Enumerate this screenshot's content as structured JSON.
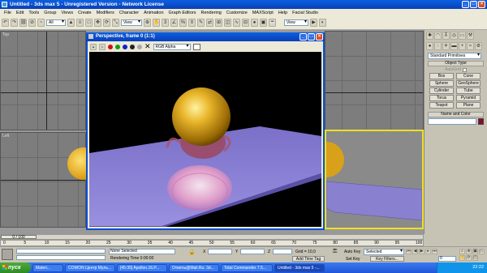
{
  "window": {
    "title": "Untitled - 3ds max 5 - Unregistered Version - Network License"
  },
  "menu": [
    "File",
    "Edit",
    "Tools",
    "Group",
    "Views",
    "Create",
    "Modifiers",
    "Character",
    "Animation",
    "Graph Editors",
    "Rendering",
    "Customize",
    "MAXScript",
    "Help",
    "Facial Studio"
  ],
  "toolbar": {
    "selection_filter": "All",
    "ref_coord": "View",
    "named_sel": "View"
  },
  "viewports": {
    "top": "Top",
    "left": "Left"
  },
  "render_window": {
    "title": "Perspective, frame 0 (1:1)",
    "channel": "RGB Alpha",
    "scene_colors": {
      "background": "#000000",
      "table": "#8a80d0",
      "sphere": "#d9a11a",
      "teapot": "#c06070"
    }
  },
  "command_panel": {
    "category": "Standard Primitives",
    "object_type_header": "Object Type",
    "autogrid": "AutoGrid",
    "buttons": [
      "Box",
      "Cone",
      "Sphere",
      "GeoSphere",
      "Cylinder",
      "Tube",
      "Torus",
      "Pyramid",
      "Teapot",
      "Plane"
    ],
    "name_color_header": "Name and Color",
    "swatch_color": "#8b0a2a"
  },
  "timeline": {
    "slider": "0 / 100",
    "ticks": [
      "0",
      "5",
      "10",
      "15",
      "20",
      "25",
      "30",
      "35",
      "40",
      "45",
      "50",
      "55",
      "60",
      "65",
      "70",
      "75",
      "80",
      "85",
      "90",
      "95",
      "100"
    ]
  },
  "status": {
    "selection": "None Selected",
    "render_time": "Rendering Time  0:00:00",
    "x_label": "X",
    "y_label": "Y",
    "z_label": "Z",
    "grid": "Grid = 10,0",
    "add_time_tag": "Add Time Tag",
    "auto_key": "Auto Key",
    "selected": "Selected",
    "set_key": "Set Key",
    "key_filters": "Key Filters...",
    "frame": "0"
  },
  "taskbar": {
    "start": "пуск",
    "tasks": [
      "Materi...",
      "COWON Центр Муль...",
      "[45:35] Apollon.16.P...",
      "Ответы@Mail.Ru: 3d...",
      "Total Commander 7.5...",
      "Untitled - 3ds max 5 -..."
    ],
    "clock": "22:22"
  }
}
